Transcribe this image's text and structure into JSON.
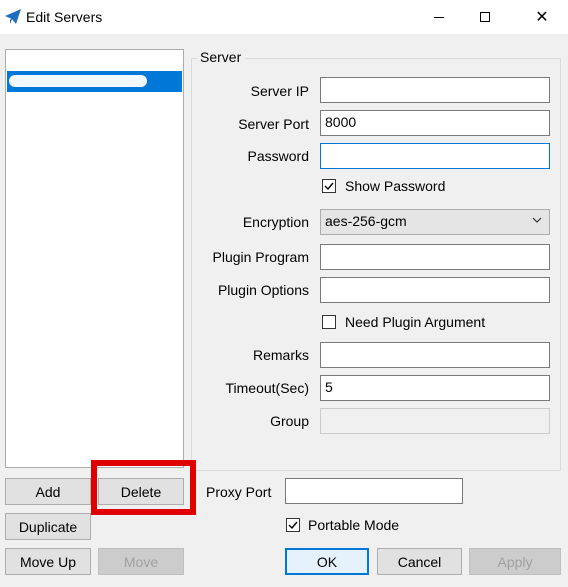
{
  "window": {
    "title": "Edit Servers",
    "app_icon": "paper-plane-icon",
    "controls": {
      "minimize": "minimize-icon",
      "maximize": "maximize-icon",
      "close": "✕"
    }
  },
  "server_list": {
    "items": [
      {
        "label": "",
        "selected": true
      }
    ]
  },
  "server_group": {
    "title": "Server",
    "server_ip": {
      "label": "Server IP",
      "value": ""
    },
    "server_port": {
      "label": "Server Port",
      "value": "8000"
    },
    "password": {
      "label": "Password",
      "value": ""
    },
    "show_password": {
      "label": "Show Password",
      "checked": true
    },
    "encryption": {
      "label": "Encryption",
      "value": "aes-256-gcm"
    },
    "plugin_program": {
      "label": "Plugin Program",
      "value": ""
    },
    "plugin_options": {
      "label": "Plugin Options",
      "value": ""
    },
    "need_plugin_argument": {
      "label": "Need Plugin Argument",
      "checked": false
    },
    "remarks": {
      "label": "Remarks",
      "value": ""
    },
    "timeout": {
      "label": "Timeout(Sec)",
      "value": "5"
    },
    "group": {
      "label": "Group",
      "value": ""
    }
  },
  "buttons": {
    "add": "Add",
    "delete": "Delete",
    "duplicate": "Duplicate",
    "move_up": "Move Up",
    "move": "Move",
    "ok": "OK",
    "cancel": "Cancel",
    "apply": "Apply"
  },
  "proxy_port": {
    "label": "Proxy Port",
    "value": ""
  },
  "portable_mode": {
    "label": "Portable Mode",
    "checked": true
  },
  "colors": {
    "accent": "#0078d7",
    "highlight": "#e00000",
    "background": "#f0f0f0"
  }
}
